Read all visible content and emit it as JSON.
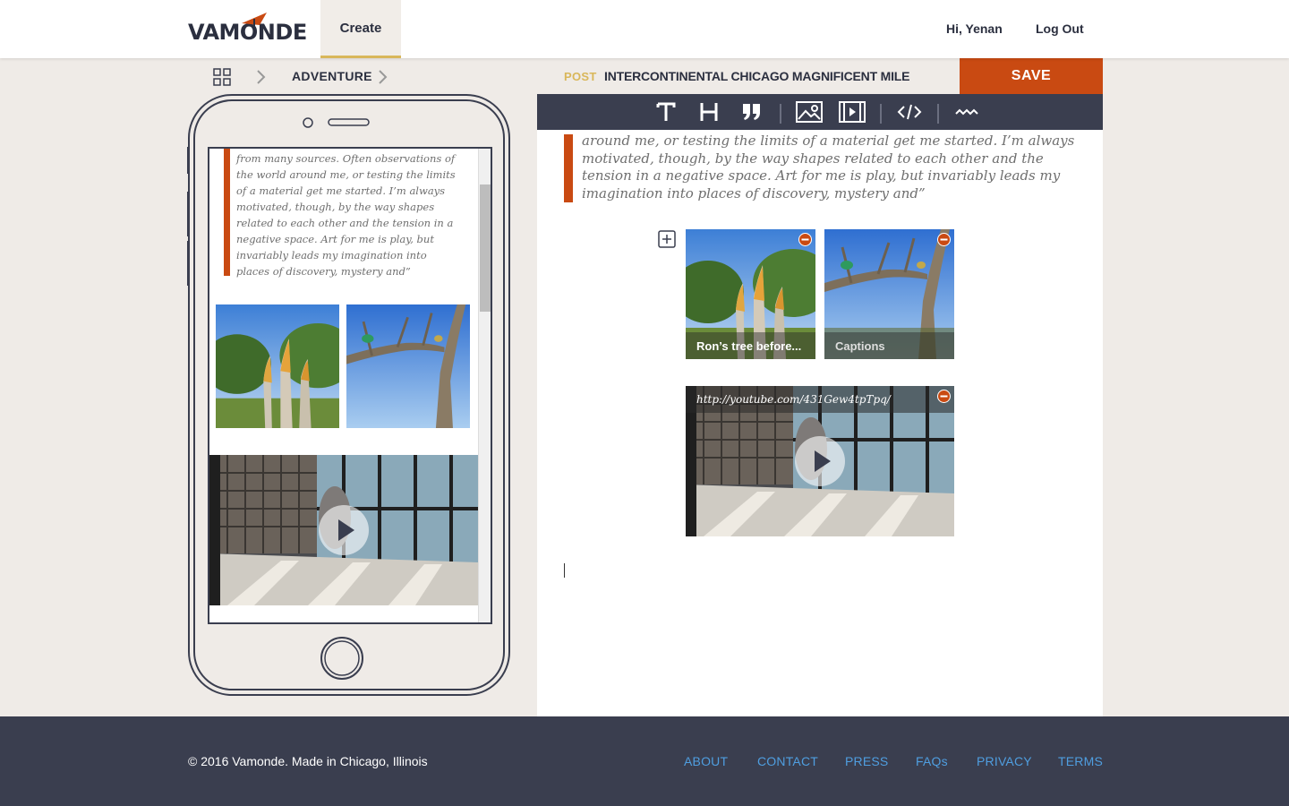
{
  "header": {
    "logo_text": "VAMONDE",
    "create_tab": "Create",
    "greeting": "Hi, Yenan",
    "logout": "Log Out"
  },
  "breadcrumb": {
    "category": "ADVENTURE"
  },
  "post": {
    "label": "POST",
    "title": "INTERCONTINENTAL CHICAGO MAGNIFICENT MILE",
    "save_label": "SAVE"
  },
  "toolbar": {
    "icons": [
      "text-icon",
      "heading-icon",
      "quote-icon",
      "image-icon",
      "video-icon",
      "code-icon",
      "divider-icon"
    ]
  },
  "editor": {
    "quote": "around me, or testing the limits of a material get me started. I’m always motivated, though, by the way shapes related to each other and the tension in a negative space. Art for me is play, but invariably leads my imagination into places of discovery, mystery and”",
    "image_captions": [
      "Ron’s tree before...",
      "Captions"
    ],
    "video_url": "http://youtube.com/431Gew4tpTpq/"
  },
  "phone_preview": {
    "quote": "from many sources. Often observations of the world around me, or testing the limits of a material get me started. I’m always motivated, though, by the way shapes related to each other and the tension in a negative space. Art for me is play, but invariably leads my imagination into places of discovery, mystery and”"
  },
  "footer": {
    "copyright": "© 2016 Vamonde. Made in Chicago, Illinois",
    "links": [
      "ABOUT",
      "CONTACT",
      "PRESS",
      "FAQs",
      "PRIVACY",
      "TERMS"
    ]
  },
  "colors": {
    "accent": "#c94a12",
    "gold": "#d9b75a",
    "dark": "#3a3e4f",
    "link": "#4f9ee0"
  }
}
